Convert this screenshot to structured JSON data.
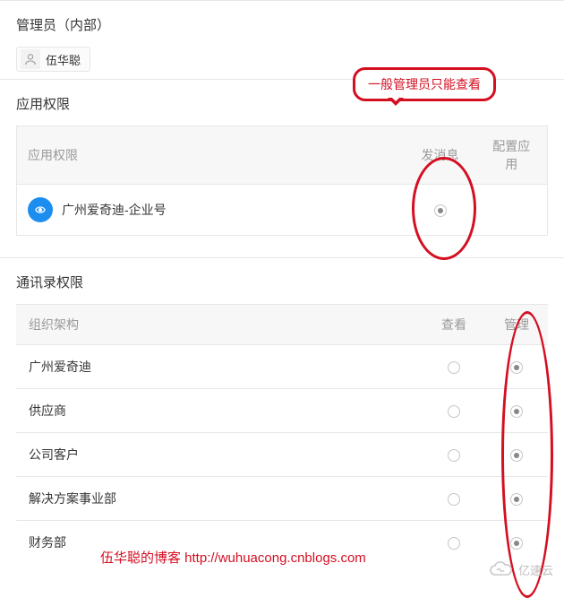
{
  "admin_section": {
    "title": "管理员（内部）",
    "admin_name": "伍华聪"
  },
  "callout": {
    "text": "一般管理员只能查看"
  },
  "app_permissions": {
    "title": "应用权限",
    "columns": {
      "name": "应用权限",
      "send_msg": "发消息",
      "config_app": "配置应用"
    },
    "rows": [
      {
        "app_name": "广州爱奇迪-企业号",
        "send_msg_checked": true,
        "config_app_checked": false
      }
    ]
  },
  "contacts_permissions": {
    "title": "通讯录权限",
    "columns": {
      "org": "组织架构",
      "view": "查看",
      "manage": "管理"
    },
    "rows": [
      {
        "org": "广州爱奇迪",
        "view_checked": false,
        "manage_checked": true
      },
      {
        "org": "供应商",
        "view_checked": false,
        "manage_checked": true
      },
      {
        "org": "公司客户",
        "view_checked": false,
        "manage_checked": true
      },
      {
        "org": "解决方案事业部",
        "view_checked": false,
        "manage_checked": true
      },
      {
        "org": "财务部",
        "view_checked": false,
        "manage_checked": true
      }
    ]
  },
  "footer": {
    "text": "伍华聪的博客 ",
    "url": "http://wuhuacong.cnblogs.com"
  },
  "logo": {
    "text": "亿速云"
  }
}
